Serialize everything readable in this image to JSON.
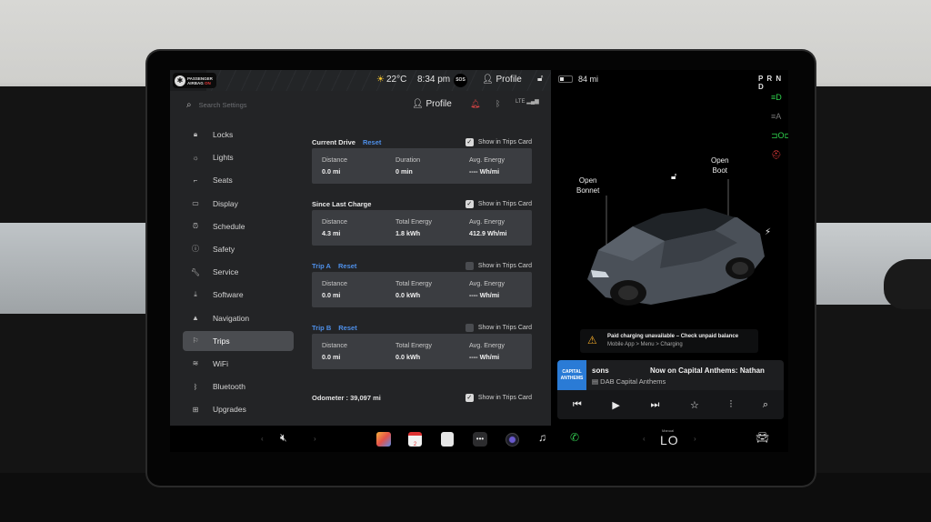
{
  "status_bar": {
    "airbag_line1": "PASSENGER",
    "airbag_line2": "AIRBAG",
    "airbag_state": "ON",
    "temperature": "22°C",
    "time": "8:34 pm",
    "sos": "SOS",
    "profile": "Profile"
  },
  "settings_header": {
    "search_placeholder": "Search Settings",
    "profile": "Profile",
    "lte": "LTE"
  },
  "sidebar": {
    "items": [
      {
        "label": "Locks",
        "icon": "lock-icon"
      },
      {
        "label": "Lights",
        "icon": "light-icon"
      },
      {
        "label": "Seats",
        "icon": "seat-icon"
      },
      {
        "label": "Display",
        "icon": "display-icon"
      },
      {
        "label": "Schedule",
        "icon": "schedule-icon"
      },
      {
        "label": "Safety",
        "icon": "safety-icon"
      },
      {
        "label": "Service",
        "icon": "wrench-icon"
      },
      {
        "label": "Software",
        "icon": "download-icon"
      },
      {
        "label": "Navigation",
        "icon": "navigation-icon"
      },
      {
        "label": "Trips",
        "icon": "trips-icon",
        "active": true
      },
      {
        "label": "WiFi",
        "icon": "wifi-icon"
      },
      {
        "label": "Bluetooth",
        "icon": "bluetooth-icon"
      },
      {
        "label": "Upgrades",
        "icon": "upgrades-icon"
      }
    ]
  },
  "trips": {
    "show_in_card_label": "Show in Trips Card",
    "reset_label": "Reset",
    "current_drive": {
      "title": "Current Drive",
      "show": true,
      "cells": [
        {
          "label": "Distance",
          "value": "0.0 mi"
        },
        {
          "label": "Duration",
          "value": "0 min"
        },
        {
          "label": "Avg. Energy",
          "value": "---- Wh/mi"
        }
      ]
    },
    "since_last_charge": {
      "title": "Since Last Charge",
      "show": true,
      "cells": [
        {
          "label": "Distance",
          "value": "4.3 mi"
        },
        {
          "label": "Total Energy",
          "value": "1.8 kWh"
        },
        {
          "label": "Avg. Energy",
          "value": "412.9 Wh/mi"
        }
      ]
    },
    "trip_a": {
      "title": "Trip A",
      "show": false,
      "cells": [
        {
          "label": "Distance",
          "value": "0.0 mi"
        },
        {
          "label": "Total Energy",
          "value": "0.0 kWh"
        },
        {
          "label": "Avg. Energy",
          "value": "---- Wh/mi"
        }
      ]
    },
    "trip_b": {
      "title": "Trip B",
      "show": false,
      "cells": [
        {
          "label": "Distance",
          "value": "0.0 mi"
        },
        {
          "label": "Total Energy",
          "value": "0.0 kWh"
        },
        {
          "label": "Avg. Energy",
          "value": "---- Wh/mi"
        }
      ]
    },
    "odometer": "Odometer : 39,097 mi",
    "odometer_show": true
  },
  "car_panel": {
    "range": "84 mi",
    "gear": "P R N D",
    "open_bonnet": "Open\nBonnet",
    "open_boot": "Open\nBoot",
    "warning_title": "Paid charging unavailable – Check unpaid balance",
    "warning_path": "Mobile App > Menu > Charging"
  },
  "media": {
    "album_text": "CAPITAL ANTHEMS",
    "track": "sons",
    "now_playing": "Now on Capital Anthems: Nathan",
    "station": "DAB Capital Anthems"
  },
  "dock": {
    "calendar_day": "2",
    "climate_mode": "Manual",
    "climate_temp": "LO"
  },
  "colors": {
    "accent_blue": "#4e8fe8",
    "panel": "#232426",
    "card": "#3b3d41",
    "active_item": "#4a4c50",
    "warning": "#f0a728"
  }
}
